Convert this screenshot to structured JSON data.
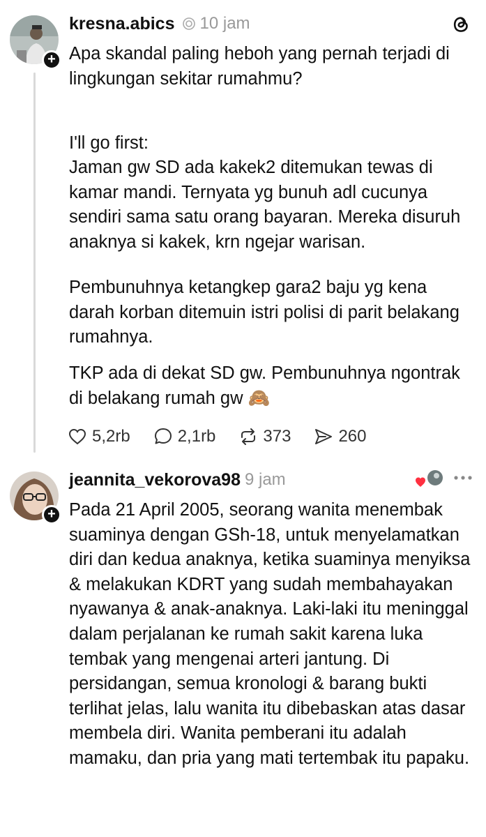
{
  "post1": {
    "username": "kresna.abics",
    "time": "10 jam",
    "paragraphs": [
      "Apa skandal paling heboh yang pernah terjadi di lingkungan sekitar rumahmu?",
      "I'll go first:\nJaman gw SD ada kakek2 ditemukan tewas di kamar mandi. Ternyata yg bunuh adl cucunya sendiri sama satu orang bayaran. Mereka disuruh anaknya si kakek, krn ngejar warisan.",
      "Pembunuhnya ketangkep gara2 baju yg kena darah korban ditemuin istri polisi di parit belakang rumahnya.",
      "TKP ada di dekat SD gw. Pembunuhnya ngontrak di belakang rumah gw 🙈"
    ],
    "likes": "5,2rb",
    "replies": "2,1rb",
    "reposts": "373",
    "shares": "260"
  },
  "post2": {
    "username": "jeannita_vekorova98",
    "time": "9 jam",
    "text": "Pada 21 April 2005, seorang wanita menembak suaminya dengan GSh-18, untuk menyelamatkan diri dan kedua anaknya, ketika suaminya menyiksa & melakukan KDRT yang sudah membahayakan nyawanya & anak-anaknya. Laki-laki itu meninggal dalam perjalanan ke rumah sakit karena luka tembak yang mengenai arteri jantung. Di persidangan, semua kronologi & barang bukti terlihat jelas, lalu wanita itu dibebaskan atas dasar membela diri. Wanita pemberani itu adalah mamaku, dan pria yang mati tertembak itu papaku."
  },
  "icons": {
    "verified": "threads-badge-icon",
    "logo": "threads-logo-icon",
    "like": "heart-icon",
    "reply": "comment-icon",
    "repost": "repost-icon",
    "share": "send-icon",
    "more": "more-icon"
  },
  "colors": {
    "text": "#111111",
    "muted": "#999999",
    "heart_red": "#ff3040"
  }
}
